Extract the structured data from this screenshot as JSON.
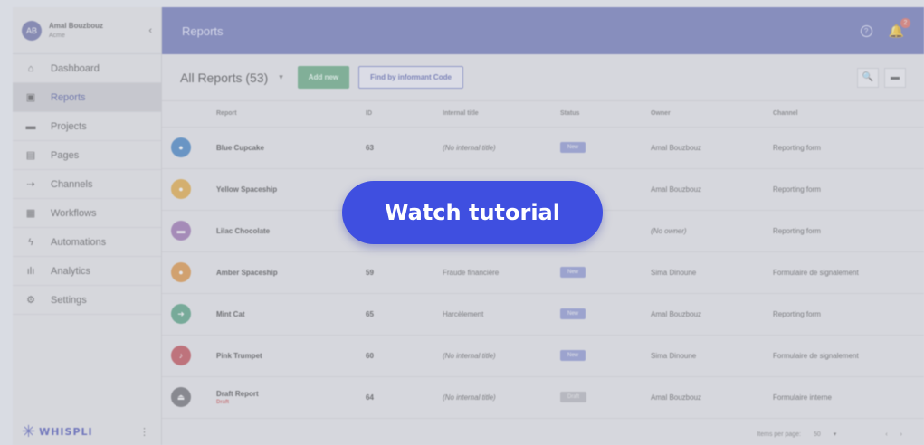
{
  "sidebar": {
    "user_name": "Amal Bouzbouz",
    "user_org": "Acme",
    "avatar_initials": "AB",
    "collapse_glyph": "‹",
    "items": [
      {
        "label": "Dashboard",
        "icon": "home-icon",
        "glyph": "⌂"
      },
      {
        "label": "Reports",
        "icon": "report-icon",
        "glyph": "▣"
      },
      {
        "label": "Projects",
        "icon": "folder-icon",
        "glyph": "▬"
      },
      {
        "label": "Pages",
        "icon": "pages-icon",
        "glyph": "▤"
      },
      {
        "label": "Channels",
        "icon": "channels-icon",
        "glyph": "⇢"
      },
      {
        "label": "Workflows",
        "icon": "workflow-icon",
        "glyph": "▦"
      },
      {
        "label": "Automations",
        "icon": "automation-icon",
        "glyph": "ϟ"
      },
      {
        "label": "Analytics",
        "icon": "analytics-icon",
        "glyph": "ılı"
      },
      {
        "label": "Settings",
        "icon": "gear-icon",
        "glyph": "⚙"
      }
    ],
    "logo_text": "WHISPLI",
    "logo_mark": "✳",
    "footer_menu_glyph": "⋮"
  },
  "topbar": {
    "title": "Reports",
    "help_glyph": "?",
    "bell_glyph": "🔔",
    "badge_count": "2"
  },
  "toolbar": {
    "title": "All Reports (53)",
    "caret": "▾",
    "add_label": "Add new",
    "find_label": "Find by informant Code",
    "search_glyph": "🔍",
    "view_glyph": "▬"
  },
  "table": {
    "headers": [
      "",
      "Report",
      "ID",
      "Internal title",
      "Status",
      "Owner",
      "Channel"
    ],
    "rows": [
      {
        "color": "#3b7fc4",
        "glyph": "●",
        "report": "Blue Cupcake",
        "sub": "",
        "id": "63",
        "title": "(No internal title)",
        "title_italic": true,
        "status": "New",
        "status_type": "new",
        "owner": "Amal Bouzbouz",
        "owner_italic": false,
        "channel": "Reporting form"
      },
      {
        "color": "#e5a93a",
        "glyph": "●",
        "report": "Yellow Spaceship",
        "sub": "",
        "id": "",
        "title": "",
        "title_italic": false,
        "status": "",
        "status_type": "new",
        "owner": "Amal Bouzbouz",
        "owner_italic": false,
        "channel": "Reporting form"
      },
      {
        "color": "#9a6fb0",
        "glyph": "▬",
        "report": "Lilac Chocolate",
        "sub": "",
        "id": "",
        "title": "",
        "title_italic": false,
        "status": "",
        "status_type": "new",
        "owner": "(No owner)",
        "owner_italic": true,
        "channel": "Reporting form"
      },
      {
        "color": "#e0913a",
        "glyph": "●",
        "report": "Amber Spaceship",
        "sub": "",
        "id": "59",
        "title": "Fraude financière",
        "title_italic": false,
        "status": "New",
        "status_type": "new",
        "owner": "Sima Dinoune",
        "owner_italic": false,
        "channel": "Formulaire de signalement"
      },
      {
        "color": "#4fa07e",
        "glyph": "➜",
        "report": "Mint Cat",
        "sub": "",
        "id": "65",
        "title": "Harcèlement",
        "title_italic": false,
        "status": "New",
        "status_type": "new",
        "owner": "Amal Bouzbouz",
        "owner_italic": false,
        "channel": "Reporting form"
      },
      {
        "color": "#c2474f",
        "glyph": "♪",
        "report": "Pink Trumpet",
        "sub": "",
        "id": "60",
        "title": "(No internal title)",
        "title_italic": true,
        "status": "New",
        "status_type": "new",
        "owner": "Sima Dinoune",
        "owner_italic": false,
        "channel": "Formulaire de signalement"
      },
      {
        "color": "#6b6b70",
        "glyph": "⏏",
        "report": "Draft Report",
        "sub": "Draft",
        "id": "64",
        "title": "(No internal title)",
        "title_italic": true,
        "status": "Draft",
        "status_type": "draft",
        "owner": "Amal Bouzbouz",
        "owner_italic": false,
        "channel": "Formulaire interne"
      }
    ]
  },
  "footer": {
    "items_per_page_label": "Items per page:",
    "items_per_page_value": "50",
    "caret": "▾",
    "prev_glyph": "‹",
    "next_glyph": "›"
  },
  "tutorial_button": "Watch tutorial"
}
